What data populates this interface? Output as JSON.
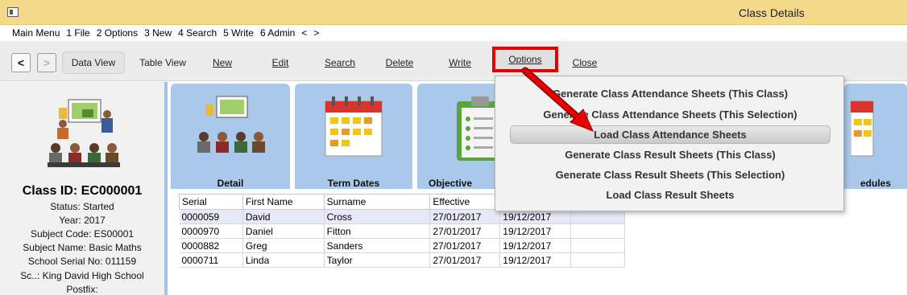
{
  "window": {
    "title": "Class Details"
  },
  "menubar": {
    "items": [
      "Main Menu",
      "1 File",
      "2 Options",
      "3 New",
      "4 Search",
      "5 Write",
      "6 Admin",
      "<",
      ">"
    ]
  },
  "toolbar": {
    "back": "<",
    "forward": ">",
    "data_view": "Data View",
    "table_view": "Table View",
    "new": "New",
    "edit": "Edit",
    "search": "Search",
    "delete": "Delete",
    "write": "Write",
    "options": "Options",
    "close": "Close"
  },
  "class_info": {
    "class_id": "Class ID: EC000001",
    "status": "Status: Started",
    "year": "Year: 2017",
    "subject_code": "Subject Code: ES00001",
    "subject_name": "Subject Name: Basic Maths",
    "school_serial": "School Serial No: 011159",
    "school": "Sc..: King David High School",
    "postfix": "Postfix:"
  },
  "tiles": {
    "detail": "Detail",
    "term_dates": "Term Dates",
    "objective": "Objective",
    "schedules": "edules"
  },
  "grid": {
    "columns": [
      "Serial",
      "First Name",
      "Surname",
      "Effective",
      ""
    ],
    "rows": [
      [
        "0000059",
        "David",
        "Cross",
        "27/01/2017",
        "19/12/2017"
      ],
      [
        "0000970",
        "Daniel",
        "Fitton",
        "27/01/2017",
        "19/12/2017"
      ],
      [
        "0000882",
        "Greg",
        "Sanders",
        "27/01/2017",
        "19/12/2017"
      ],
      [
        "0000711",
        "Linda",
        "Taylor",
        "27/01/2017",
        "19/12/2017"
      ]
    ]
  },
  "options_menu": {
    "items": [
      "Generate Class Attendance Sheets (This Class)",
      "Generate Class Attendance Sheets (This Selection)",
      "Load Class Attendance Sheets",
      "Generate Class Result Sheets (This Class)",
      "Generate Class Result Sheets (This Selection)",
      "Load Class Result Sheets"
    ],
    "highlighted_index": 2
  },
  "colors": {
    "titlebar": "#f4d98b",
    "tile": "#aac9ea",
    "annotation": "#e60000"
  }
}
